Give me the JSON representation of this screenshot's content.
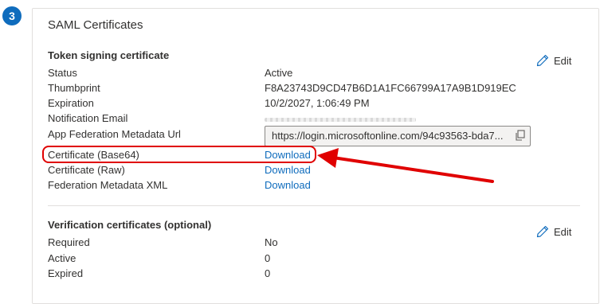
{
  "step": {
    "number": "3"
  },
  "card": {
    "title": "SAML Certificates"
  },
  "token_signing": {
    "title": "Token signing certificate",
    "edit_label": "Edit",
    "rows": [
      {
        "label": "Status",
        "value": "Active"
      },
      {
        "label": "Thumbprint",
        "value": "F8A23743D9CD47B6D1A1FC66799A17A9B1D919EC"
      },
      {
        "label": "Expiration",
        "value": "10/2/2027, 1:06:49 PM"
      },
      {
        "label": "Notification Email",
        "value": ""
      },
      {
        "label": "App Federation Metadata Url",
        "value": "https://login.microsoftonline.com/94c93563-bda7..."
      },
      {
        "label": "Certificate (Base64)",
        "value": "Download"
      },
      {
        "label": "Certificate (Raw)",
        "value": "Download"
      },
      {
        "label": "Federation Metadata XML",
        "value": "Download"
      }
    ]
  },
  "verification": {
    "title": "Verification certificates (optional)",
    "edit_label": "Edit",
    "rows": [
      {
        "label": "Required",
        "value": "No"
      },
      {
        "label": "Active",
        "value": "0"
      },
      {
        "label": "Expired",
        "value": "0"
      }
    ]
  },
  "colors": {
    "accent": "#0f6cbd",
    "annotation": "#e00000"
  },
  "icons": {
    "edit": "pencil-icon",
    "copy": "copy-icon"
  }
}
